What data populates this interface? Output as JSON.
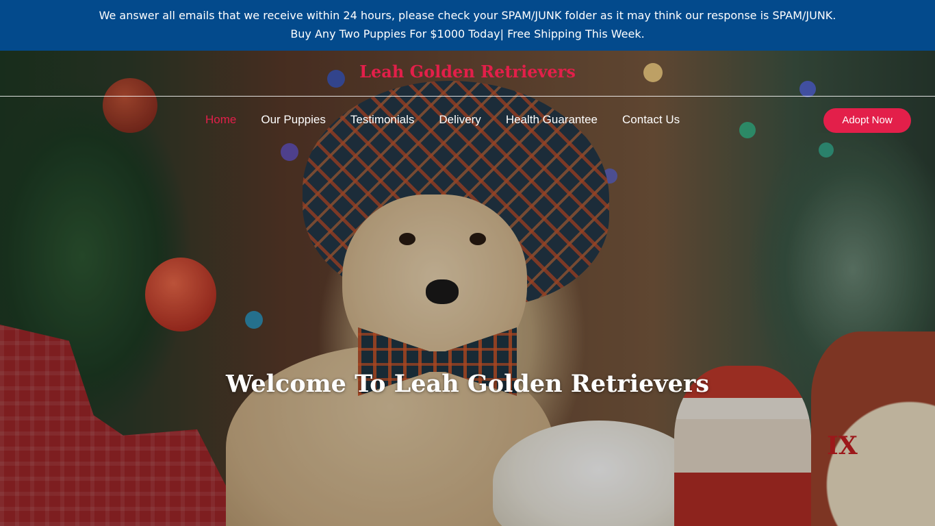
{
  "notice": {
    "line1": "We answer all emails that we receive within 24 hours, please check your SPAM/JUNK folder as it may think our response is SPAM/JUNK.",
    "line2": "Buy Any Two Puppies For $1000 Today| Free Shipping This Week."
  },
  "header": {
    "brand": "Leah Golden Retrievers",
    "nav": [
      {
        "label": "Home",
        "active": true
      },
      {
        "label": "Our Puppies"
      },
      {
        "label": "Testimonials"
      },
      {
        "label": "Delivery"
      },
      {
        "label": "Health Guarantee"
      },
      {
        "label": "Contact Us"
      }
    ],
    "cta": "Adopt Now"
  },
  "hero": {
    "title": "Welcome To Leah Golden Retrievers",
    "image_description_icon": "golden-retriever-puppy-christmas-image",
    "clock_numeral": "IX"
  },
  "colors": {
    "notice_bg": "#034a8c",
    "accent": "#e31f4a",
    "text_light": "#ffffff"
  }
}
